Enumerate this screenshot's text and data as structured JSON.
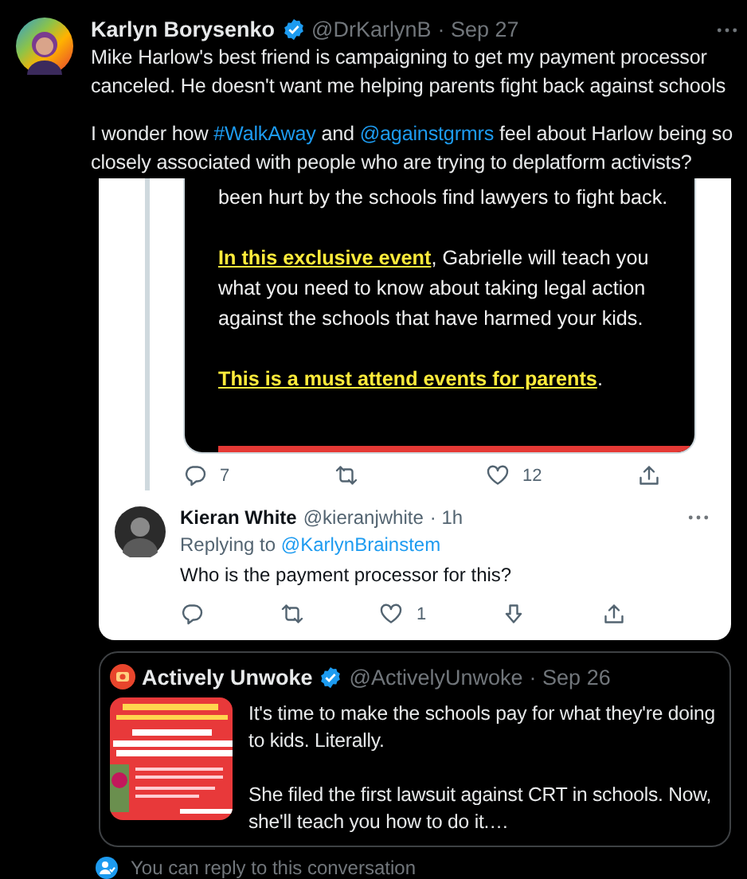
{
  "tweet": {
    "author": "Karlyn Borysenko",
    "verified": true,
    "handle": "@DrKarlynB",
    "date": "· Sep 27",
    "paragraphs": [
      [
        {
          "kind": "text",
          "text": "Mike Harlow's best friend is campaigning to get my payment processor canceled. He doesn't want me helping parents fight back against schools"
        }
      ],
      [
        {
          "kind": "text",
          "text": "I wonder how "
        },
        {
          "kind": "link",
          "text": "#WalkAway"
        },
        {
          "kind": "text",
          "text": " and "
        },
        {
          "kind": "link",
          "text": "@againstgrmrs"
        },
        {
          "kind": "text",
          "text": " feel about Harlow being so closely associated with people who are trying to deplatform activists?"
        }
      ]
    ]
  },
  "embedded_screenshot": {
    "image_paragraphs": [
      [
        {
          "kind": "text",
          "text": "been hurt by the schools find lawyers to fight back."
        }
      ],
      [
        {
          "kind": "highlight",
          "text": "In this exclusive event"
        },
        {
          "kind": "text",
          "text": ", Gabrielle will teach you what you need to know about taking legal action against the schools that have harmed your kids."
        }
      ],
      [
        {
          "kind": "highlight",
          "text": "This is a must attend events for parents"
        },
        {
          "kind": "text",
          "text": "."
        }
      ]
    ],
    "actions": [
      {
        "kind": "reply",
        "count": "7"
      },
      {
        "kind": "retweet"
      },
      {
        "kind": "like",
        "count": "12"
      },
      {
        "kind": "share"
      }
    ],
    "reply": {
      "author": "Kieran White",
      "handle": "@kieranjwhite",
      "time": "· 1h",
      "replying_label": "Replying to",
      "replying_to": "@KarlynBrainstem",
      "text": "Who is the payment processor for this?",
      "actions": [
        {
          "kind": "reply"
        },
        {
          "kind": "retweet"
        },
        {
          "kind": "like",
          "count": "1"
        },
        {
          "kind": "download"
        },
        {
          "kind": "share"
        }
      ]
    }
  },
  "quote": {
    "author": "Actively Unwoke",
    "verified": true,
    "handle": "@ActivelyUnwoke",
    "date": "· Sep 26",
    "thumbnail": {
      "kind": "picture"
    },
    "paragraphs": [
      "It's time to make the schools pay for what they're doing to kids. Literally.",
      "She filed the first lawsuit against CRT in schools. Now, she'll teach you how to do it.…"
    ]
  },
  "footer": {
    "text": "You can reply to this conversation"
  }
}
